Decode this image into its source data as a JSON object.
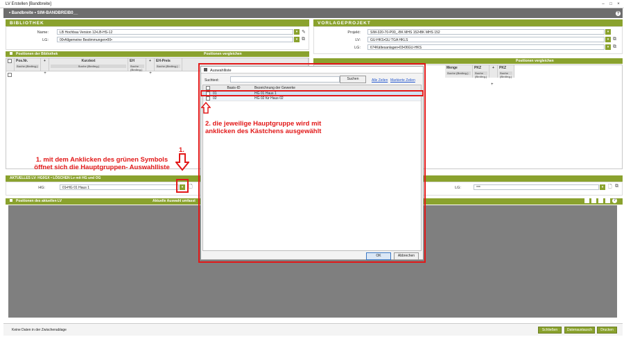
{
  "window": {
    "title": "LV Erstellen [Bandbreite]"
  },
  "appbar": {
    "title": "• Bandbreite • SIM-BANDBREIB0__"
  },
  "bibliothek": {
    "header": "BIBLIOTHEK",
    "name_label": "Name:",
    "name_value": "LB Hochbau Version 12•LB-HS-12",
    "lg_label": "LG:",
    "lg_value": "00•Allgemeine Bestimmungen•00•",
    "positions_header": "Positionen der Bibliothek",
    "compare_header": "Positionen vergleichen",
    "columns": [
      "Pos.Nr.",
      "Kurztext",
      "EH",
      "EH-Preis"
    ],
    "filter_text": "Suche (Beding.)"
  },
  "vorlage": {
    "header": "VORLAGEPROJEKT",
    "projekt_label": "Projekt:",
    "projekt_value": "SIM-320-70-P00_-BK MHS 152•BK MHS 152",
    "lv_label": "LV:",
    "lv_value": "GU-HKS•GU TGA HKLS",
    "lg_label": "LG:",
    "lg_value": "674Kältesanlagen•03•06GU-HKS",
    "compare_header": "Positionen vergleichen",
    "columns": [
      "Menge",
      "PKZ",
      "PKZ"
    ]
  },
  "aktuell": {
    "header": "AKTUELLES LV: HG0GX • LÖSCHEN Lv mit HG und OG",
    "hg_label": "HG:",
    "hg_value": "01•HG 01 Haus 1",
    "lg_label": "LG:",
    "lg_value": "***",
    "positions_header": "Positionen des aktuellen LV",
    "selection_header": "Aktuelle Auswahl umfasst"
  },
  "dialog": {
    "title": "Auswahlliste",
    "search_label": "Suchtext:",
    "search_value": "",
    "search_button": "Suchen",
    "link_all": "Alle Zeilen",
    "link_marked": "Markierte Zeilen",
    "col_basis": "Basis-ID",
    "col_bez": "Bezeichnung der Gewerke",
    "rows": [
      {
        "id": "01",
        "name": "HG 01 Haus 1"
      },
      {
        "id": "02",
        "name": "HG 02 für Haus 02"
      }
    ],
    "ok_button": "OK",
    "cancel_button": "Abbrechen"
  },
  "annotations": {
    "step1_number": "1.",
    "step1_text_line1": "1. mit dem Anklicken des grünen Symbols",
    "step1_text_line2": "öffnet sich die Hauptgruppen- Auswahlliste",
    "step2_text_line1": "2. die jeweilige Hauptgruppe wird mit",
    "step2_text_line2": "anklicken des Kästchens ausgewählt"
  },
  "footer": {
    "status": "Keine Daten in der Zwischenablage",
    "close_button": "Schließen",
    "exchange_button": "Datenaustausch",
    "print_button": "Drucken"
  },
  "colors": {
    "accent": "#8aa22e",
    "annotation": "#e21818",
    "appbar": "#6d6d6d"
  }
}
